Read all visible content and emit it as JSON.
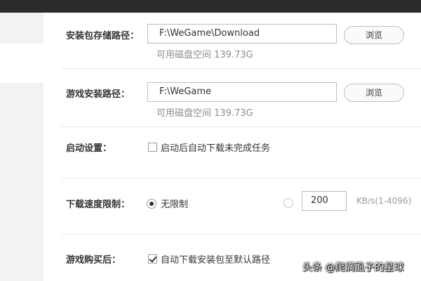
{
  "settings": {
    "package_path": {
      "label": "安装包存储路径：",
      "value": "F:\\WeGame\\Download",
      "browse_label": "浏览",
      "space": "可用磁盘空间 139.73G"
    },
    "install_path": {
      "label": "游戏安装路径：",
      "value": "F:\\WeGame",
      "browse_label": "浏览",
      "space": "可用磁盘空间 139.73G"
    },
    "startup": {
      "label": "启动设置：",
      "option": "启动后自动下载未完成任务",
      "checked": false
    },
    "speed_limit": {
      "label": "下载速度限制：",
      "unlimited_label": "无限制",
      "unlimited_selected": true,
      "limit_value": "200",
      "unit": "KB/s(1-4096)"
    },
    "after_purchase": {
      "label": "游戏购买后：",
      "option": "自动下载安装包至默认路径",
      "checked": true
    }
  },
  "watermark": "头条 @爬满虱子的星球",
  "colors": {
    "topbar": "#2b2b2e",
    "sidebar": "#f2f2f2",
    "divider": "#e6e6e6"
  }
}
